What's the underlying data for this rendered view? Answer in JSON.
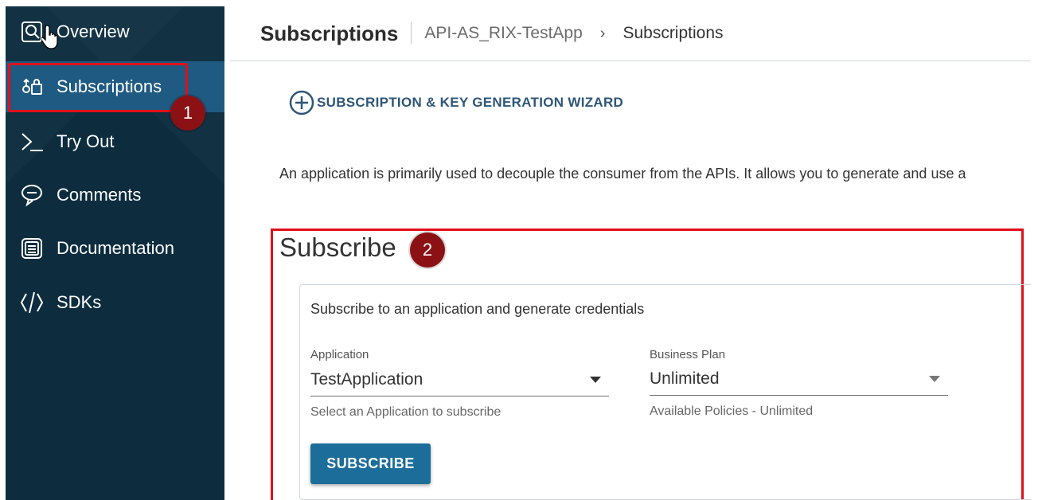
{
  "sidebar": {
    "items": [
      {
        "label": "Overview",
        "icon": "overview-icon"
      },
      {
        "label": "Subscriptions",
        "icon": "subscriptions-icon"
      },
      {
        "label": "Try Out",
        "icon": "terminal-icon"
      },
      {
        "label": "Comments",
        "icon": "comment-icon"
      },
      {
        "label": "Documentation",
        "icon": "document-icon"
      },
      {
        "label": "SDKs",
        "icon": "code-icon"
      }
    ],
    "active_index": 1
  },
  "callouts": {
    "one": "1",
    "two": "2"
  },
  "header": {
    "title": "Subscriptions",
    "breadcrumb": [
      "API-AS_RIX-TestApp",
      "Subscriptions"
    ],
    "chevron": "›"
  },
  "wizard": {
    "label": "SUBSCRIPTION & KEY GENERATION WIZARD",
    "icon": "plus-circle-icon"
  },
  "description": "An application is primarily used to decouple the consumer from the APIs. It allows you to generate and use a",
  "subscribe": {
    "heading": "Subscribe",
    "caption": "Subscribe to an application and generate credentials",
    "application": {
      "label": "Application",
      "value": "TestApplication",
      "hint": "Select an Application to subscribe"
    },
    "business_plan": {
      "label": "Business Plan",
      "value": "Unlimited",
      "hint": "Available Policies - Unlimited"
    },
    "button": "SUBSCRIBE"
  },
  "colors": {
    "sidebar_bg": "#0d2d3f",
    "active_bg": "#1e5a82",
    "highlight": "#e0101a",
    "badge": "#8b1115",
    "button": "#1d6d9b",
    "link": "#2e5678"
  }
}
